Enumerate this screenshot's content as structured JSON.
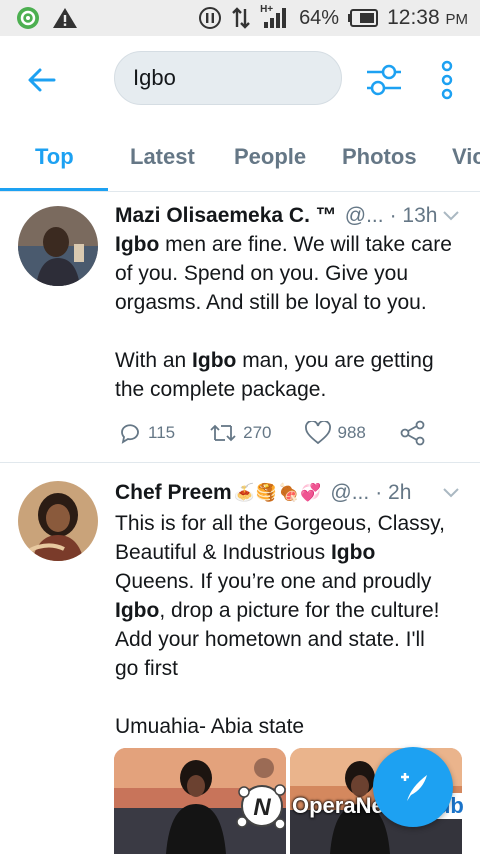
{
  "status_bar": {
    "battery_percent": "64%",
    "time": "12:38",
    "ampm": "PM",
    "network": "H+"
  },
  "search": {
    "query": "Igbo"
  },
  "tabs": [
    {
      "label": "Top",
      "active": true
    },
    {
      "label": "Latest",
      "active": false
    },
    {
      "label": "People",
      "active": false
    },
    {
      "label": "Photos",
      "active": false
    },
    {
      "label": "Vic",
      "active": false
    }
  ],
  "tweets": [
    {
      "name": "Mazi Olisaemeka C. ™",
      "handle": "@...",
      "time": "· 13h",
      "lines": [
        {
          "bold": "Igbo",
          "rest": " men are fine. We will take care"
        },
        {
          "bold": "",
          "rest": "of you. Spend on you. Give you"
        },
        {
          "bold": "",
          "rest": "orgasms. And still be loyal to you."
        },
        {
          "bold": "",
          "rest": ""
        },
        {
          "pre": "With an ",
          "bold": "Igbo",
          "rest": " man, you are getting"
        },
        {
          "bold": "",
          "rest": "the complete package."
        }
      ],
      "replies": "115",
      "retweets": "270",
      "likes": "988"
    },
    {
      "name": "Chef Preem",
      "name_emoji": "🍝🥞🍖💞",
      "handle": "@...",
      "time": "· 2h",
      "lines": [
        {
          "pre": "This is for all the Gorgeous, Classy,",
          "bold": "",
          "rest": ""
        },
        {
          "pre": "Beautiful & Industrious ",
          "bold": "Igbo",
          "rest": ""
        },
        {
          "pre": "Queens. If you’re one and proudly",
          "bold": "",
          "rest": ""
        },
        {
          "pre": "",
          "bold": "Igbo",
          "rest": ", drop a picture for the culture!"
        },
        {
          "pre": "Add your hometown and state.  I'll",
          "bold": "",
          "rest": ""
        },
        {
          "pre": "go first",
          "bold": "",
          "rest": ""
        },
        {
          "pre": "",
          "bold": "",
          "rest": ""
        },
        {
          "pre": "Umuahia- Abia state",
          "bold": "",
          "rest": ""
        }
      ]
    }
  ],
  "watermark": {
    "text": "OperaNews",
    "hub": "Hub"
  },
  "colors": {
    "accent": "#1da1f2",
    "muted": "#657786",
    "divider": "#e1e8ed"
  },
  "icons": [
    "back-arrow-icon",
    "filter-sliders-icon",
    "overflow-menu-icon",
    "reply-icon",
    "retweet-icon",
    "like-icon",
    "share-icon",
    "compose-tweet-icon"
  ]
}
